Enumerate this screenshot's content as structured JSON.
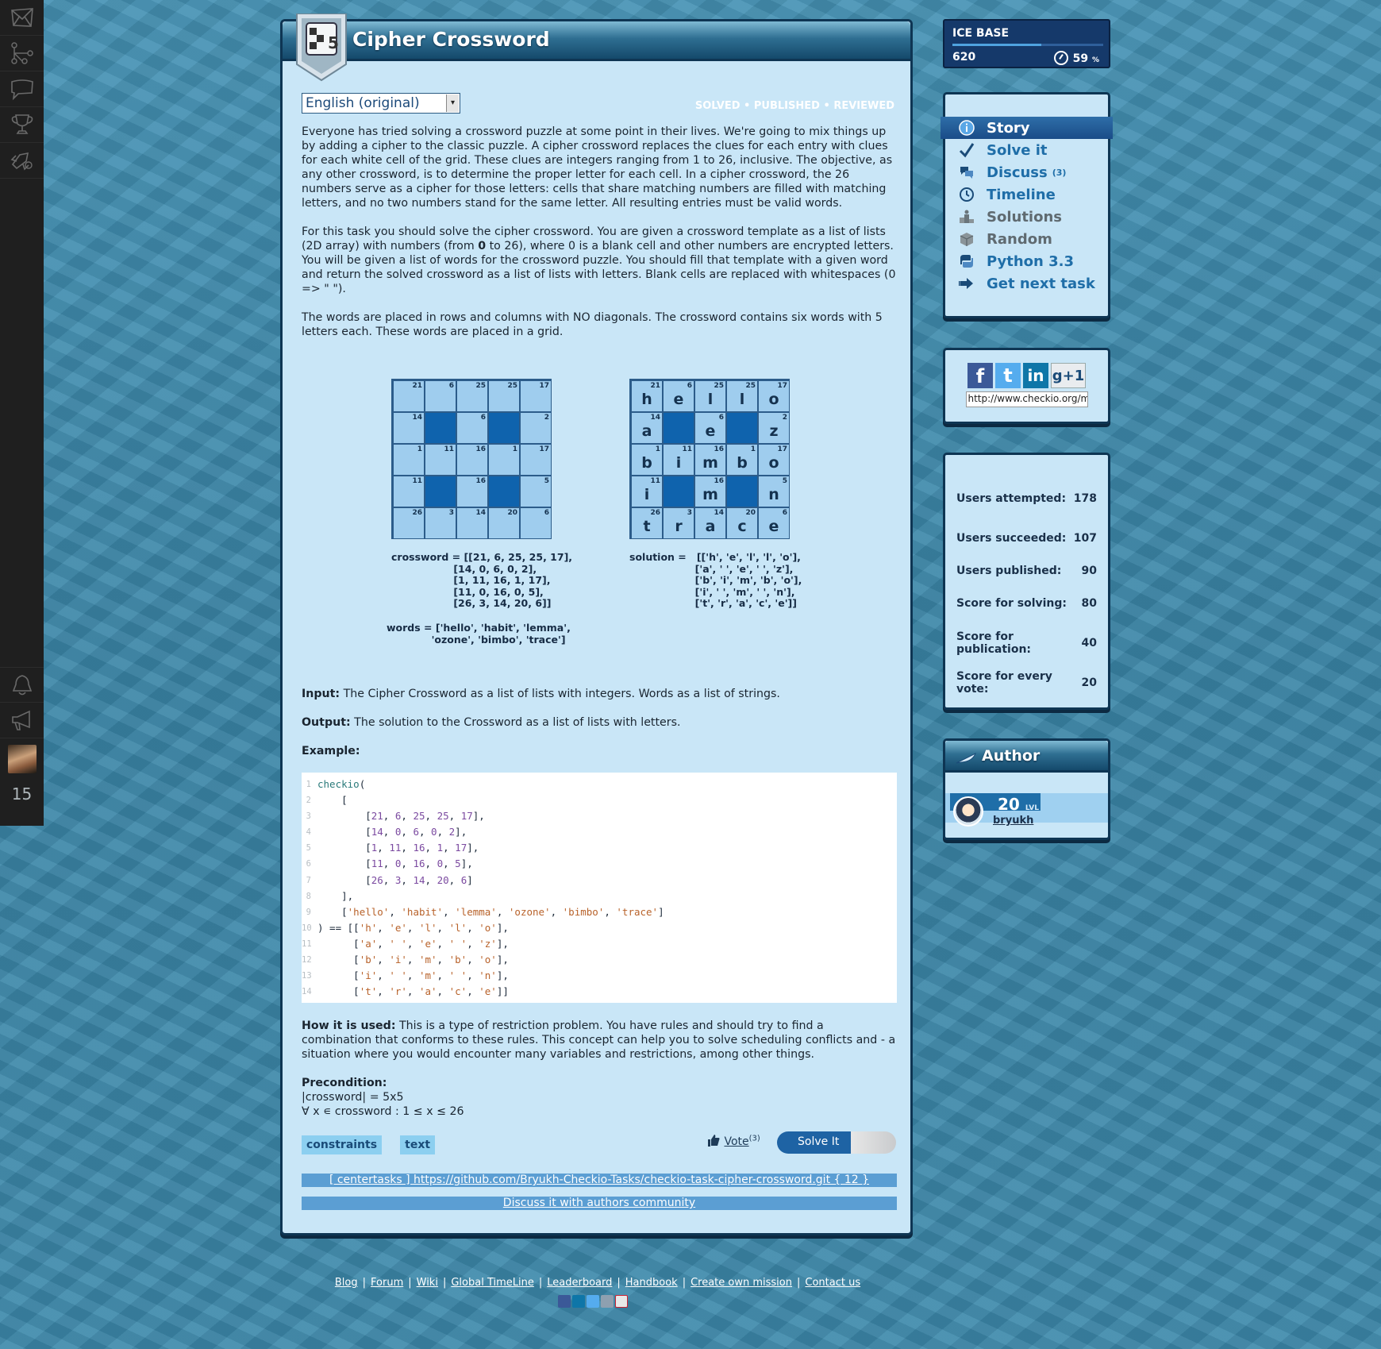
{
  "left_nav": {
    "icons": [
      "envelope-icon",
      "hierarchy-icon",
      "speech-bubble-icon",
      "trophy-icon",
      "rocket-icon"
    ],
    "bottom_icons": [
      "bell-icon",
      "megaphone-icon"
    ],
    "user_level": "15"
  },
  "mission": {
    "title": "Cipher Crossword",
    "language": "English (original)",
    "statuses": [
      "SOLVED",
      "PUBLISHED",
      "REVIEWED"
    ],
    "status_sep": " • ",
    "description": [
      "Everyone has tried solving a crossword puzzle at some point in their lives. We're going to mix things up by adding a cipher to the classic puzzle. A cipher crossword replaces the clues for each entry with clues for each white cell of the grid. These clues are integers ranging from 1 to 26, inclusive. The objective, as any other crossword, is to determine the proper letter for each cell. In a cipher crossword, the 26 numbers serve as a cipher for those letters: cells that share matching numbers are filled with matching letters, and no two numbers stand for the same letter. All resulting entries must be valid words.",
      "For this task you should solve the cipher crossword. You are given a crossword template as a list of lists (2D array) with numbers (from 0 to 26), where 0 is a blank cell and other numbers are encrypted letters. You will be given a list of words for the crossword puzzle. You should fill that template with a given word and return the solved crossword as a list of lists with letters. Blank cells are replaced with whitespaces (0 => \" \").",
      "The words are placed in rows and columns with NO diagonals. The crossword contains six words with 5 letters each. These words are placed in a grid."
    ],
    "crossword_numbers": [
      [
        21,
        6,
        25,
        25,
        17
      ],
      [
        14,
        0,
        6,
        0,
        2
      ],
      [
        1,
        11,
        16,
        1,
        17
      ],
      [
        11,
        0,
        16,
        0,
        5
      ],
      [
        26,
        3,
        14,
        20,
        6
      ]
    ],
    "solution_letters": [
      [
        "h",
        "e",
        "l",
        "l",
        "o"
      ],
      [
        "a",
        " ",
        "e",
        " ",
        "z"
      ],
      [
        "b",
        "i",
        "m",
        "b",
        "o"
      ],
      [
        "i",
        " ",
        "m",
        " ",
        "n"
      ],
      [
        "t",
        "r",
        "a",
        "c",
        "e"
      ]
    ],
    "crossword_caption": "crossword = [[21, 6, 25, 25, 17],\n                  [14, 0, 6, 0, 2],\n                  [1, 11, 16, 1, 17],\n                  [11, 0, 16, 0, 5],\n                  [26, 3, 14, 20, 6]]",
    "words_caption": "words = ['hello', 'habit', 'lemma',\n             'ozone', 'bimbo', 'trace']",
    "solution_caption": "solution =   [['h', 'e', 'l', 'l', 'o'],\n                   ['a', ' ', 'e', ' ', 'z'],\n                   ['b', 'i', 'm', 'b', 'o'],\n                   ['i', ' ', 'm', ' ', 'n'],\n                   ['t', 'r', 'a', 'c', 'e']]",
    "input_label": "Input:",
    "input_text": "The Cipher Crossword as a list of lists with integers. Words as a list of strings.",
    "output_label": "Output:",
    "output_text": "The solution to the Crossword as a list of lists with letters.",
    "example_label": "Example:",
    "example_code": [
      "checkio(",
      "    [",
      "        [21, 6, 25, 25, 17],",
      "        [14, 0, 6, 0, 2],",
      "        [1, 11, 16, 1, 17],",
      "        [11, 0, 16, 0, 5],",
      "        [26, 3, 14, 20, 6]",
      "    ],",
      "    ['hello', 'habit', 'lemma', 'ozone', 'bimbo', 'trace']",
      ") == [['h', 'e', 'l', 'l', 'o'],",
      "      ['a', ' ', 'e', ' ', 'z'],",
      "      ['b', 'i', 'm', 'b', 'o'],",
      "      ['i', ' ', 'm', ' ', 'n'],",
      "      ['t', 'r', 'a', 'c', 'e']]"
    ],
    "how_used_label": "How it is used:",
    "how_used_text": "This is a type of restriction problem. You have rules and should try to find a combination that conforms to these rules. This concept can help you to solve scheduling conflicts and - a situation where you would encounter many variables and restrictions, among other things.",
    "precondition_label": "Precondition:",
    "precondition_lines": [
      "|crossword| = 5x5",
      "∀ x ∊ crossword : 1 ≤ x ≤ 26"
    ],
    "tags": [
      "constraints",
      "text"
    ],
    "vote_label": "Vote",
    "vote_count": "(3)",
    "solve_button": "Solve It",
    "repo_link": "[ centertasks ] https://github.com/Bryukh-Checkio-Tasks/checkio-task-cipher-crossword.git { 12 }",
    "discuss_link": "Discuss it with authors community"
  },
  "ice_base": {
    "title": "ICE BASE",
    "score": "620",
    "percent": "59",
    "percent_unit": "%",
    "progress": 0.59
  },
  "side_menu": [
    {
      "label": "Story",
      "icon": "info-icon",
      "active": true
    },
    {
      "label": "Solve it",
      "icon": "checkmark-icon"
    },
    {
      "label": "Discuss",
      "icon": "speech-bubbles-icon",
      "count": "(3)"
    },
    {
      "label": "Timeline",
      "icon": "clock-icon"
    },
    {
      "label": "Solutions",
      "icon": "podium-icon",
      "grey": true
    },
    {
      "label": "Random",
      "icon": "box-icon",
      "grey": true
    },
    {
      "label": "Python 3.3",
      "icon": "python-icon"
    },
    {
      "label": "Get next task",
      "icon": "arrow-right-icon"
    }
  ],
  "share": {
    "url": "http://www.checkio.org/mis",
    "buttons": [
      "facebook-icon",
      "twitter-icon",
      "linkedin-icon",
      "google-plus-one-icon"
    ]
  },
  "stats": [
    {
      "label": "Users attempted:",
      "value": "178"
    },
    {
      "label": "Users succeeded:",
      "value": "107"
    },
    {
      "label": "Users published:",
      "value": "90"
    },
    {
      "label": "Score for solving:",
      "value": "80"
    },
    {
      "label": "Score for publication:",
      "value": "40"
    },
    {
      "label": "Score for every vote:",
      "value": "20"
    }
  ],
  "author": {
    "title": "Author",
    "level": "20",
    "level_unit": "LVL",
    "name": "bryukh"
  },
  "footer": {
    "links": [
      "Blog",
      "Forum",
      "Wiki",
      "Global TimeLine",
      "Leaderboard",
      "Handbook",
      "Create own mission",
      "Contact us"
    ],
    "icons": [
      "facebook-icon",
      "linkedin-icon",
      "twitter-icon",
      "google-plus-icon",
      "gmail-icon"
    ]
  },
  "colors": {
    "panel_bg": "#c9e6f7",
    "panel_border": "#0e3553",
    "link_blue": "#1f6ea8",
    "cell_light": "#9fcdee",
    "cell_dark": "#0f63ad"
  }
}
